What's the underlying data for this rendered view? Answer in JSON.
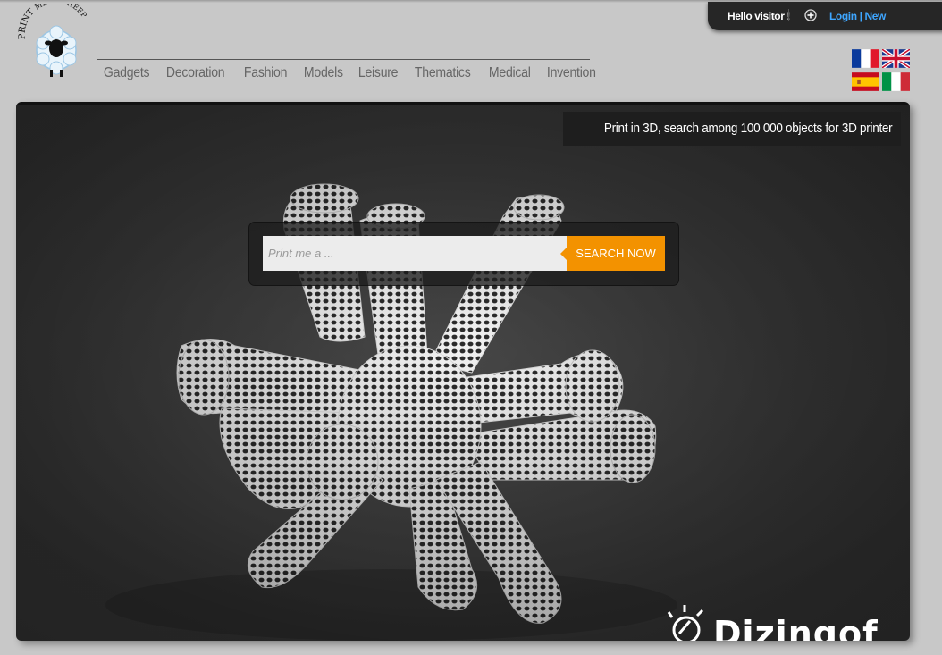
{
  "logo": {
    "text_top": "PRINT",
    "text_me": "ME",
    "text_a": "A",
    "text_sheep": "SHEEP"
  },
  "nav": {
    "items": [
      {
        "label": "Gadgets"
      },
      {
        "label": "Decoration"
      },
      {
        "label": "Fashion"
      },
      {
        "label": "Models"
      },
      {
        "label": "Leisure"
      },
      {
        "label": "Thematics"
      },
      {
        "label": "Medical"
      },
      {
        "label": "Invention"
      }
    ]
  },
  "user": {
    "greeting": "Hello visitor !",
    "login_label": "Login | New"
  },
  "flags": [
    {
      "icon": "flag-fr-icon"
    },
    {
      "icon": "flag-uk-icon"
    },
    {
      "icon": "flag-es-icon"
    },
    {
      "icon": "flag-it-icon"
    }
  ],
  "hero": {
    "tagline": "Print in 3D, search among 100 000 objects for 3D printer",
    "watermark": "Dizingof"
  },
  "search": {
    "placeholder": "Print me a ...",
    "button_label": "SEARCH NOW"
  },
  "colors": {
    "accent": "#f39200",
    "link": "#3ea6ff",
    "page_bg": "#c8c8c8",
    "hero_bg": "#3a3a3a"
  }
}
